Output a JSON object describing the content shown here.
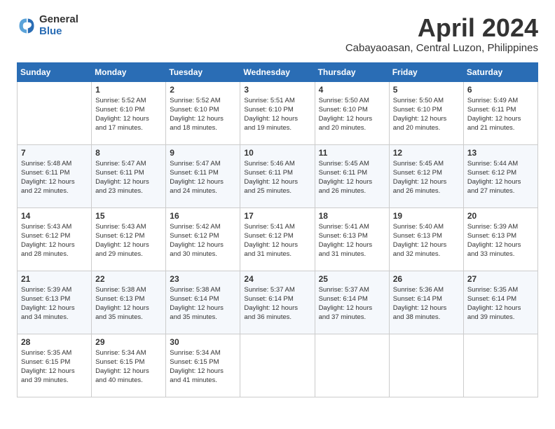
{
  "logo": {
    "general": "General",
    "blue": "Blue"
  },
  "title": "April 2024",
  "location": "Cabayaoasan, Central Luzon, Philippines",
  "weekdays": [
    "Sunday",
    "Monday",
    "Tuesday",
    "Wednesday",
    "Thursday",
    "Friday",
    "Saturday"
  ],
  "weeks": [
    [
      {
        "day": "",
        "info": ""
      },
      {
        "day": "1",
        "info": "Sunrise: 5:52 AM\nSunset: 6:10 PM\nDaylight: 12 hours\nand 17 minutes."
      },
      {
        "day": "2",
        "info": "Sunrise: 5:52 AM\nSunset: 6:10 PM\nDaylight: 12 hours\nand 18 minutes."
      },
      {
        "day": "3",
        "info": "Sunrise: 5:51 AM\nSunset: 6:10 PM\nDaylight: 12 hours\nand 19 minutes."
      },
      {
        "day": "4",
        "info": "Sunrise: 5:50 AM\nSunset: 6:10 PM\nDaylight: 12 hours\nand 20 minutes."
      },
      {
        "day": "5",
        "info": "Sunrise: 5:50 AM\nSunset: 6:10 PM\nDaylight: 12 hours\nand 20 minutes."
      },
      {
        "day": "6",
        "info": "Sunrise: 5:49 AM\nSunset: 6:11 PM\nDaylight: 12 hours\nand 21 minutes."
      }
    ],
    [
      {
        "day": "7",
        "info": "Sunrise: 5:48 AM\nSunset: 6:11 PM\nDaylight: 12 hours\nand 22 minutes."
      },
      {
        "day": "8",
        "info": "Sunrise: 5:47 AM\nSunset: 6:11 PM\nDaylight: 12 hours\nand 23 minutes."
      },
      {
        "day": "9",
        "info": "Sunrise: 5:47 AM\nSunset: 6:11 PM\nDaylight: 12 hours\nand 24 minutes."
      },
      {
        "day": "10",
        "info": "Sunrise: 5:46 AM\nSunset: 6:11 PM\nDaylight: 12 hours\nand 25 minutes."
      },
      {
        "day": "11",
        "info": "Sunrise: 5:45 AM\nSunset: 6:11 PM\nDaylight: 12 hours\nand 26 minutes."
      },
      {
        "day": "12",
        "info": "Sunrise: 5:45 AM\nSunset: 6:12 PM\nDaylight: 12 hours\nand 26 minutes."
      },
      {
        "day": "13",
        "info": "Sunrise: 5:44 AM\nSunset: 6:12 PM\nDaylight: 12 hours\nand 27 minutes."
      }
    ],
    [
      {
        "day": "14",
        "info": "Sunrise: 5:43 AM\nSunset: 6:12 PM\nDaylight: 12 hours\nand 28 minutes."
      },
      {
        "day": "15",
        "info": "Sunrise: 5:43 AM\nSunset: 6:12 PM\nDaylight: 12 hours\nand 29 minutes."
      },
      {
        "day": "16",
        "info": "Sunrise: 5:42 AM\nSunset: 6:12 PM\nDaylight: 12 hours\nand 30 minutes."
      },
      {
        "day": "17",
        "info": "Sunrise: 5:41 AM\nSunset: 6:12 PM\nDaylight: 12 hours\nand 31 minutes."
      },
      {
        "day": "18",
        "info": "Sunrise: 5:41 AM\nSunset: 6:13 PM\nDaylight: 12 hours\nand 31 minutes."
      },
      {
        "day": "19",
        "info": "Sunrise: 5:40 AM\nSunset: 6:13 PM\nDaylight: 12 hours\nand 32 minutes."
      },
      {
        "day": "20",
        "info": "Sunrise: 5:39 AM\nSunset: 6:13 PM\nDaylight: 12 hours\nand 33 minutes."
      }
    ],
    [
      {
        "day": "21",
        "info": "Sunrise: 5:39 AM\nSunset: 6:13 PM\nDaylight: 12 hours\nand 34 minutes."
      },
      {
        "day": "22",
        "info": "Sunrise: 5:38 AM\nSunset: 6:13 PM\nDaylight: 12 hours\nand 35 minutes."
      },
      {
        "day": "23",
        "info": "Sunrise: 5:38 AM\nSunset: 6:14 PM\nDaylight: 12 hours\nand 35 minutes."
      },
      {
        "day": "24",
        "info": "Sunrise: 5:37 AM\nSunset: 6:14 PM\nDaylight: 12 hours\nand 36 minutes."
      },
      {
        "day": "25",
        "info": "Sunrise: 5:37 AM\nSunset: 6:14 PM\nDaylight: 12 hours\nand 37 minutes."
      },
      {
        "day": "26",
        "info": "Sunrise: 5:36 AM\nSunset: 6:14 PM\nDaylight: 12 hours\nand 38 minutes."
      },
      {
        "day": "27",
        "info": "Sunrise: 5:35 AM\nSunset: 6:14 PM\nDaylight: 12 hours\nand 39 minutes."
      }
    ],
    [
      {
        "day": "28",
        "info": "Sunrise: 5:35 AM\nSunset: 6:15 PM\nDaylight: 12 hours\nand 39 minutes."
      },
      {
        "day": "29",
        "info": "Sunrise: 5:34 AM\nSunset: 6:15 PM\nDaylight: 12 hours\nand 40 minutes."
      },
      {
        "day": "30",
        "info": "Sunrise: 5:34 AM\nSunset: 6:15 PM\nDaylight: 12 hours\nand 41 minutes."
      },
      {
        "day": "",
        "info": ""
      },
      {
        "day": "",
        "info": ""
      },
      {
        "day": "",
        "info": ""
      },
      {
        "day": "",
        "info": ""
      }
    ]
  ]
}
